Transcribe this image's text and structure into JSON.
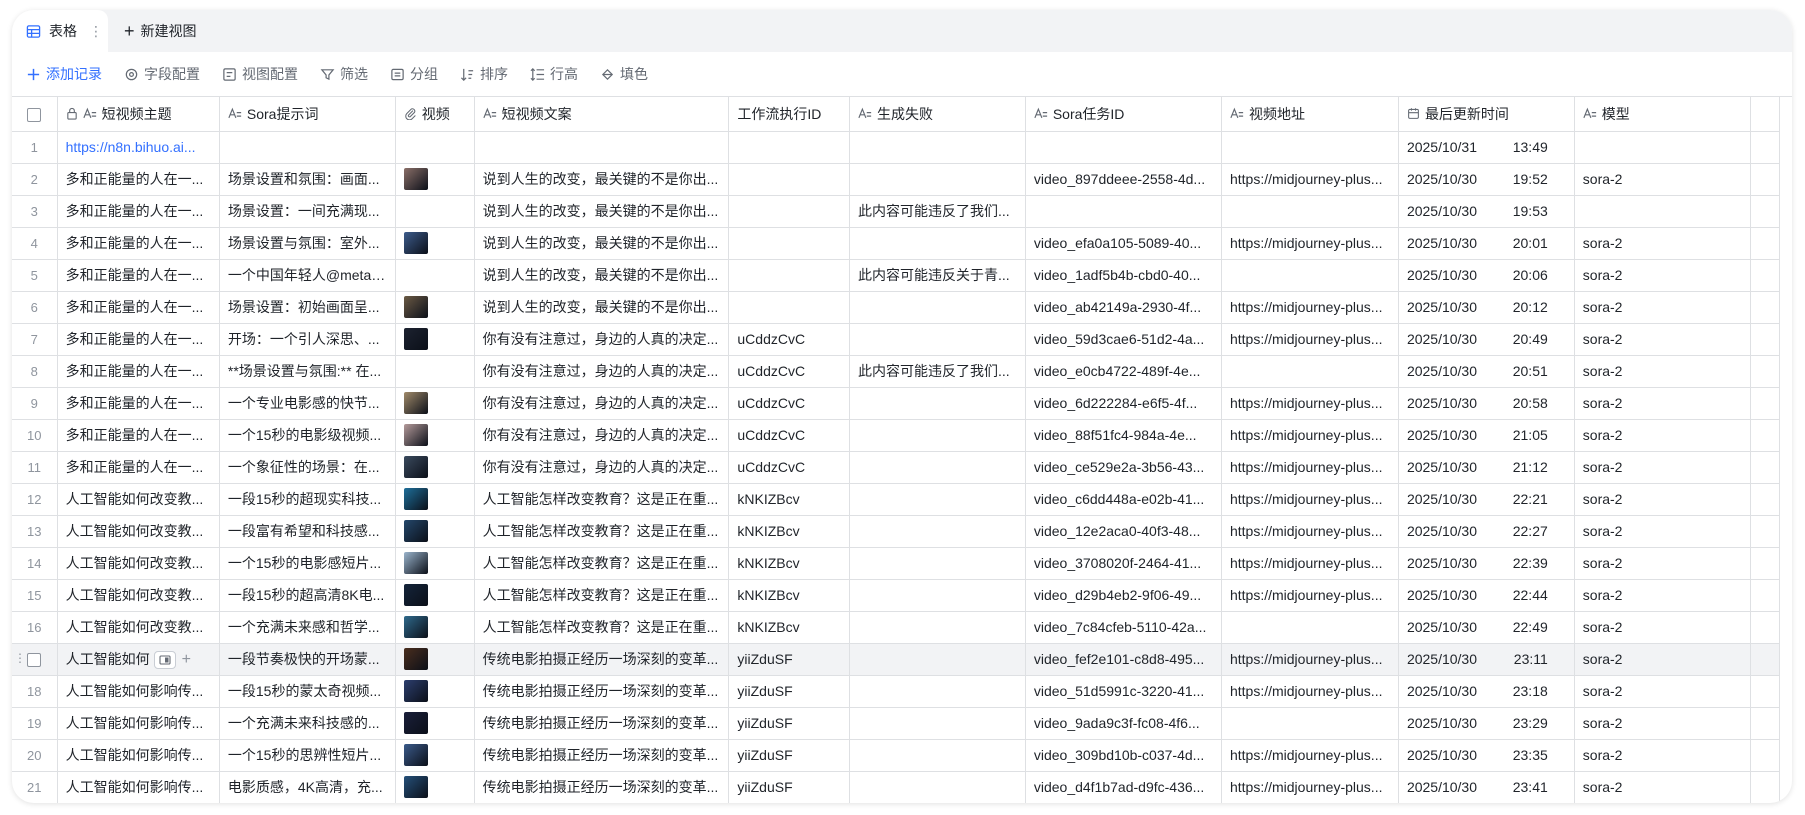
{
  "tabs": {
    "active_label": "表格",
    "more": "⋮",
    "new_view_label": "新建视图"
  },
  "toolbar": {
    "add_record": "添加记录",
    "field_config": "字段配置",
    "view_config": "视图配置",
    "filter": "筛选",
    "group": "分组",
    "sort": "排序",
    "row_height": "行高",
    "fill_color": "填色"
  },
  "columns": [
    "短视频主题",
    "Sora提示词",
    "视频",
    "短视频文案",
    "工作流执行ID",
    "生成失败",
    "Sora任务ID",
    "视频地址",
    "最后更新时间",
    "模型"
  ],
  "rows": [
    {
      "no": "1",
      "topic": "https://n8n.bihuo.ai...",
      "prompt": "",
      "thumb": "",
      "copy": "",
      "exec": "",
      "fail": "",
      "task": "",
      "url": "",
      "date": "2025/10/31",
      "time": "13:49",
      "model": ""
    },
    {
      "no": "2",
      "topic": "多和正能量的人在一...",
      "prompt": "场景设置和氛围：画面...",
      "thumb": "#8a6f68",
      "copy": "说到人生的改变，最关键的不是你出...",
      "exec": "",
      "fail": "",
      "task": "video_897ddeee-2558-4d...",
      "url": "https://midjourney-plus...",
      "date": "2025/10/30",
      "time": "19:52",
      "model": "sora-2"
    },
    {
      "no": "3",
      "topic": "多和正能量的人在一...",
      "prompt": "场景设置：一间充满现...",
      "thumb": "",
      "copy": "说到人生的改变，最关键的不是你出...",
      "exec": "",
      "fail": "此内容可能违反了我们...",
      "task": "",
      "url": "",
      "date": "2025/10/30",
      "time": "19:53",
      "model": ""
    },
    {
      "no": "4",
      "topic": "多和正能量的人在一...",
      "prompt": "场景设置与氛围：室外...",
      "thumb": "#3d5c8c",
      "copy": "说到人生的改变，最关键的不是你出...",
      "exec": "",
      "fail": "",
      "task": "video_efa0a105-5089-40...",
      "url": "https://midjourney-plus...",
      "date": "2025/10/30",
      "time": "20:01",
      "model": "sora-2"
    },
    {
      "no": "5",
      "topic": "多和正能量的人在一...",
      "prompt": "一个中国年轻人@metaf...",
      "thumb": "",
      "copy": "说到人生的改变，最关键的不是你出...",
      "exec": "",
      "fail": "此内容可能违反关于青...",
      "task": "video_1adf5b4b-cbd0-40...",
      "url": "",
      "date": "2025/10/30",
      "time": "20:06",
      "model": "sora-2"
    },
    {
      "no": "6",
      "topic": "多和正能量的人在一...",
      "prompt": "场景设置：初始画面呈...",
      "thumb": "#6b5a45",
      "copy": "说到人生的改变，最关键的不是你出...",
      "exec": "",
      "fail": "",
      "task": "video_ab42149a-2930-4f...",
      "url": "https://midjourney-plus...",
      "date": "2025/10/30",
      "time": "20:12",
      "model": "sora-2"
    },
    {
      "no": "7",
      "topic": "多和正能量的人在一...",
      "prompt": "开场：一个引人深思、...",
      "thumb": "#1c2230",
      "copy": "你有没有注意过，身边的人真的决定...",
      "exec": "uCddzCvC",
      "fail": "",
      "task": "video_59d3cae6-51d2-4a...",
      "url": "https://midjourney-plus...",
      "date": "2025/10/30",
      "time": "20:49",
      "model": "sora-2"
    },
    {
      "no": "8",
      "topic": "多和正能量的人在一...",
      "prompt": "**场景设置与氛围:** 在...",
      "thumb": "",
      "copy": "你有没有注意过，身边的人真的决定...",
      "exec": "uCddzCvC",
      "fail": "此内容可能违反了我们...",
      "task": "video_e0cb4722-489f-4e...",
      "url": "",
      "date": "2025/10/30",
      "time": "20:51",
      "model": "sora-2"
    },
    {
      "no": "9",
      "topic": "多和正能量的人在一...",
      "prompt": "一个专业电影感的快节...",
      "thumb": "#a08a6a",
      "copy": "你有没有注意过，身边的人真的决定...",
      "exec": "uCddzCvC",
      "fail": "",
      "task": "video_6d222284-e6f5-4f...",
      "url": "https://midjourney-plus...",
      "date": "2025/10/30",
      "time": "20:58",
      "model": "sora-2"
    },
    {
      "no": "10",
      "topic": "多和正能量的人在一...",
      "prompt": "一个15秒的电影级视频...",
      "thumb": "#b49a9a",
      "copy": "你有没有注意过，身边的人真的决定...",
      "exec": "uCddzCvC",
      "fail": "",
      "task": "video_88f51fc4-984a-4e...",
      "url": "https://midjourney-plus...",
      "date": "2025/10/30",
      "time": "21:05",
      "model": "sora-2"
    },
    {
      "no": "11",
      "topic": "多和正能量的人在一...",
      "prompt": "一个象征性的场景：在...",
      "thumb": "#3a4a5e",
      "copy": "你有没有注意过，身边的人真的决定...",
      "exec": "uCddzCvC",
      "fail": "",
      "task": "video_ce529e2a-3b56-43...",
      "url": "https://midjourney-plus...",
      "date": "2025/10/30",
      "time": "21:12",
      "model": "sora-2"
    },
    {
      "no": "12",
      "topic": "人工智能如何改变教...",
      "prompt": "一段15秒的超现实科技...",
      "thumb": "#1e6f9a",
      "copy": "人工智能怎样改变教育？这是正在重...",
      "exec": "kNKIZBcv",
      "fail": "",
      "task": "video_c6dd448a-e02b-41...",
      "url": "https://midjourney-plus...",
      "date": "2025/10/30",
      "time": "22:21",
      "model": "sora-2"
    },
    {
      "no": "13",
      "topic": "人工智能如何改变教...",
      "prompt": "一段富有希望和科技感...",
      "thumb": "#24476b",
      "copy": "人工智能怎样改变教育？这是正在重...",
      "exec": "kNKIZBcv",
      "fail": "",
      "task": "video_12e2aca0-40f3-48...",
      "url": "https://midjourney-plus...",
      "date": "2025/10/30",
      "time": "22:27",
      "model": "sora-2"
    },
    {
      "no": "14",
      "topic": "人工智能如何改变教...",
      "prompt": "一个15秒的电影感短片...",
      "thumb": "#9ab4cc",
      "copy": "人工智能怎样改变教育？这是正在重...",
      "exec": "kNKIZBcv",
      "fail": "",
      "task": "video_3708020f-2464-41...",
      "url": "https://midjourney-plus...",
      "date": "2025/10/30",
      "time": "22:39",
      "model": "sora-2"
    },
    {
      "no": "15",
      "topic": "人工智能如何改变教...",
      "prompt": "一段15秒的超高清8K电...",
      "thumb": "#14243a",
      "copy": "人工智能怎样改变教育？这是正在重...",
      "exec": "kNKIZBcv",
      "fail": "",
      "task": "video_d29b4eb2-9f06-49...",
      "url": "https://midjourney-plus...",
      "date": "2025/10/30",
      "time": "22:44",
      "model": "sora-2"
    },
    {
      "no": "16",
      "topic": "人工智能如何改变教...",
      "prompt": "一个充满未来感和哲学...",
      "thumb": "#2f6a8c",
      "copy": "人工智能怎样改变教育？这是正在重...",
      "exec": "kNKIZBcv",
      "fail": "",
      "task": "video_7c84cfeb-5110-42a...",
      "url": "",
      "date": "2025/10/30",
      "time": "22:49",
      "model": "sora-2"
    },
    {
      "no": "",
      "topic": "人工智能如何",
      "prompt": "一段节奏极快的开场蒙...",
      "thumb": "#4a2e1e",
      "copy": "传统电影拍摄正经历一场深刻的变革...",
      "exec": "yiiZduSF",
      "fail": "",
      "task": "video_fef2e101-c8d8-495...",
      "url": "https://midjourney-plus...",
      "date": "2025/10/30",
      "time": "23:11",
      "model": "sora-2",
      "hover": true
    },
    {
      "no": "18",
      "topic": "人工智能如何影响传...",
      "prompt": "一段15秒的蒙太奇视频...",
      "thumb": "#2c3e6e",
      "copy": "传统电影拍摄正经历一场深刻的变革...",
      "exec": "yiiZduSF",
      "fail": "",
      "task": "video_51d5991c-3220-41...",
      "url": "https://midjourney-plus...",
      "date": "2025/10/30",
      "time": "23:18",
      "model": "sora-2"
    },
    {
      "no": "19",
      "topic": "人工智能如何影响传...",
      "prompt": "一个充满未来科技感的...",
      "thumb": "#1a1f3a",
      "copy": "传统电影拍摄正经历一场深刻的变革...",
      "exec": "yiiZduSF",
      "fail": "",
      "task": "video_9ada9c3f-fc08-4f6...",
      "url": "",
      "date": "2025/10/30",
      "time": "23:29",
      "model": "sora-2"
    },
    {
      "no": "20",
      "topic": "人工智能如何影响传...",
      "prompt": "一个15秒的思辨性短片...",
      "thumb": "#3a5a8a",
      "copy": "传统电影拍摄正经历一场深刻的变革...",
      "exec": "yiiZduSF",
      "fail": "",
      "task": "video_309bd10b-c037-4d...",
      "url": "https://midjourney-plus...",
      "date": "2025/10/30",
      "time": "23:35",
      "model": "sora-2"
    },
    {
      "no": "21",
      "topic": "人工智能如何影响传...",
      "prompt": "电影质感，4K高清，充...",
      "thumb": "#25507a",
      "copy": "传统电影拍摄正经历一场深刻的变革...",
      "exec": "yiiZduSF",
      "fail": "",
      "task": "video_d4f1b7ad-d9fc-436...",
      "url": "https://midjourney-plus...",
      "date": "2025/10/30",
      "time": "23:41",
      "model": "sora-2"
    }
  ],
  "colors": {
    "accent": "#3370ff",
    "border": "#dee0e3",
    "muted": "#8f959e"
  }
}
